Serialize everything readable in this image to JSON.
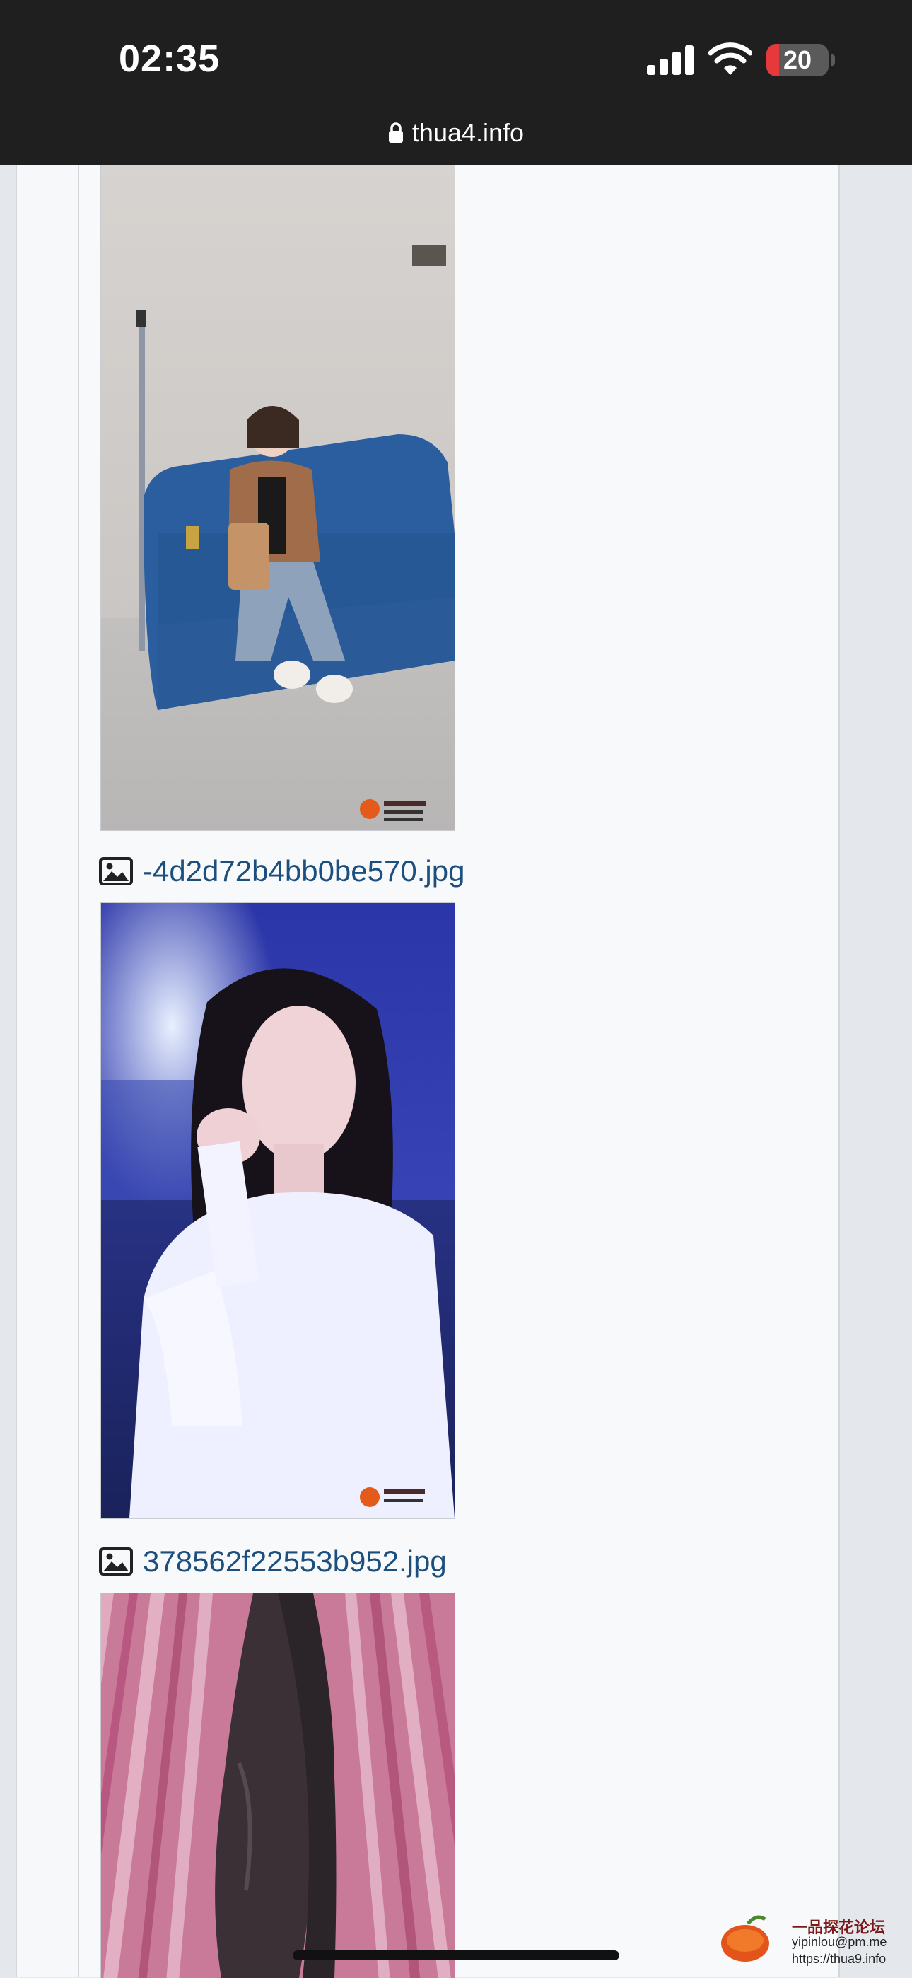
{
  "status_bar": {
    "time": "02:35",
    "battery_level": "20",
    "battery_fraction": 0.2
  },
  "address_bar": {
    "domain": "thua4.info"
  },
  "posts": {
    "file_2_name": "-4d2d72b4bb0be570.jpg",
    "file_3_name": "378562f22553b952.jpg"
  },
  "watermark": {
    "title": "一品探花论坛",
    "email": "yipinlou@pm.me",
    "url": "https://thua9.info"
  },
  "colors": {
    "link": "#1d4f7e",
    "battery_low": "#e5393b"
  }
}
